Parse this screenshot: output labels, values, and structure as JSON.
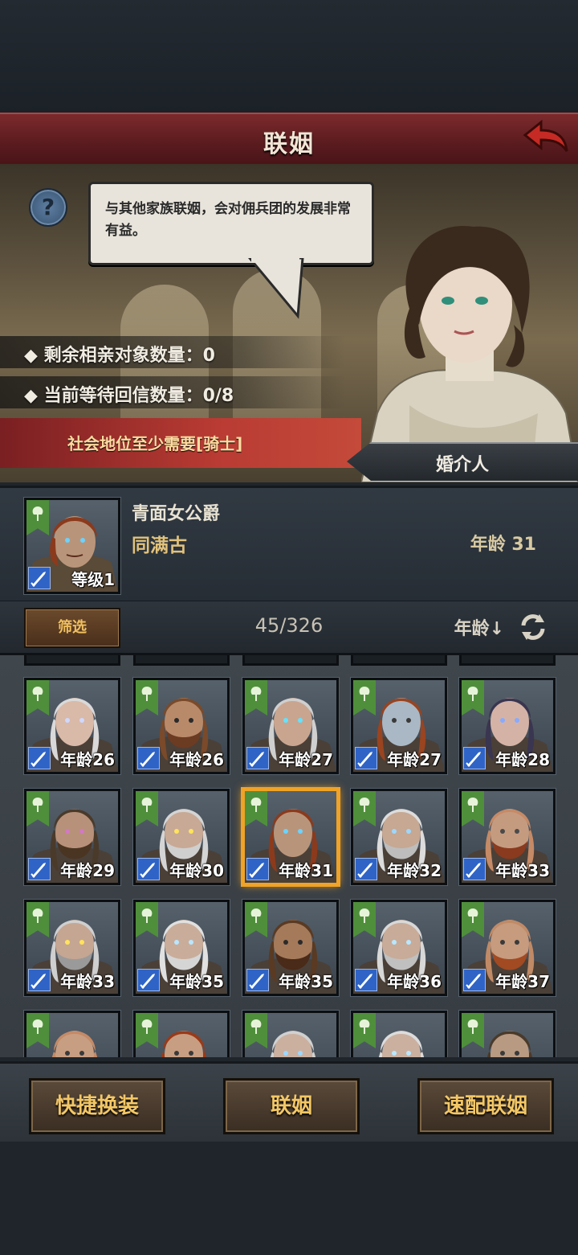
{
  "header": {
    "title": "联姻"
  },
  "intro": {
    "speech": "与其他家族联姻，会对佣兵团的发展非常有益。"
  },
  "stats": {
    "remaining": "◆ 剩余相亲对象数量：0",
    "waiting": "◆ 当前等待回信数量：0/8"
  },
  "requirement": "社会地位至少需要[骑士]",
  "matchmaker_label": "婚介人",
  "selected": {
    "title": "青面女公爵",
    "name": "同满古",
    "age_label": "年龄 31",
    "level_label": "等级1"
  },
  "filter": {
    "button": "筛选",
    "count": "45/326",
    "sort_label": "年龄↓"
  },
  "candidates": [
    {
      "age": "年龄26",
      "hair": "#d9d9d9",
      "skin": "#d9b9a8",
      "beard": "",
      "eye": "#cfd8ff"
    },
    {
      "age": "年龄26",
      "hair": "#7a4a2a",
      "skin": "#b98a6a",
      "beard": "#6b3b22",
      "eye": "#2a2a2a"
    },
    {
      "age": "年龄27",
      "hair": "#cfcfcf",
      "skin": "#c9a590",
      "beard": "",
      "eye": "#62e3ff"
    },
    {
      "age": "年龄27",
      "hair": "#9a4420",
      "skin": "#a9b8c4",
      "beard": "",
      "eye": "#3a3a3a"
    },
    {
      "age": "年龄28",
      "hair": "#3a3550",
      "skin": "#d4b3a6",
      "beard": "",
      "eye": "#88aaff"
    },
    {
      "age": "年龄29",
      "hair": "#4a3a2a",
      "skin": "#b8917a",
      "beard": "#4a3522",
      "eye": "#d07ac0"
    },
    {
      "age": "年龄30",
      "hair": "#d4d4d4",
      "skin": "#c8a995",
      "beard": "#cfcfcf",
      "eye": "#ffe45a"
    },
    {
      "age": "年龄31",
      "hair": "#8c3a1c",
      "skin": "#b8957a",
      "beard": "",
      "eye": "#6ad3ff"
    },
    {
      "age": "年龄32",
      "hair": "#dcdcdc",
      "skin": "#c6a893",
      "beard": "#bdbdbd",
      "eye": "#9bd8ff"
    },
    {
      "age": "年龄33",
      "hair": "#c58a66",
      "skin": "#c59b80",
      "beard": "#8a3a1e",
      "eye": "#4a4a4a"
    },
    {
      "age": "年龄33",
      "hair": "#cfcfcf",
      "skin": "#c5a692",
      "beard": "#9a9a9a",
      "eye": "#ffe45a"
    },
    {
      "age": "年龄35",
      "hair": "#e0e0e0",
      "skin": "#c9ad9a",
      "beard": "#d5d5d5",
      "eye": "#b9e6ff"
    },
    {
      "age": "年龄35",
      "hair": "#5a3a22",
      "skin": "#a57a5a",
      "beard": "#4a2a18",
      "eye": "#2a2a2a"
    },
    {
      "age": "年龄36",
      "hair": "#d8d8d8",
      "skin": "#c8ab98",
      "beard": "#c0c0c0",
      "eye": "#b8e8ff"
    },
    {
      "age": "年龄37",
      "hair": "#c08a66",
      "skin": "#c69b7e",
      "beard": "#a24a22",
      "eye": "#3a3a3a"
    },
    {
      "age": "",
      "hair": "#c48a66",
      "skin": "#c89e82",
      "beard": "",
      "eye": "#3a3a3a"
    },
    {
      "age": "",
      "hair": "#9a3a18",
      "skin": "#c89e82",
      "beard": "",
      "eye": "#3a3a3a"
    },
    {
      "age": "",
      "hair": "#d0d0d0",
      "skin": "#cbb0a0",
      "beard": "",
      "eye": "#9bd8ff"
    },
    {
      "age": "",
      "hair": "#dcdcdc",
      "skin": "#cbb0a0",
      "beard": "",
      "eye": "#b8e8ff"
    },
    {
      "age": "",
      "hair": "#4a3a2a",
      "skin": "#b89a82",
      "beard": "",
      "eye": "#3a3a3a"
    }
  ],
  "selected_index": 7,
  "actions": {
    "quick_equip": "快捷换装",
    "marry": "联姻",
    "quick_match": "速配联姻"
  },
  "colors": {
    "title_red": "#5a1b1f",
    "accent_gold": "#f3c766",
    "banner_green": "#4f8f3c",
    "selection": "#f0a326"
  }
}
